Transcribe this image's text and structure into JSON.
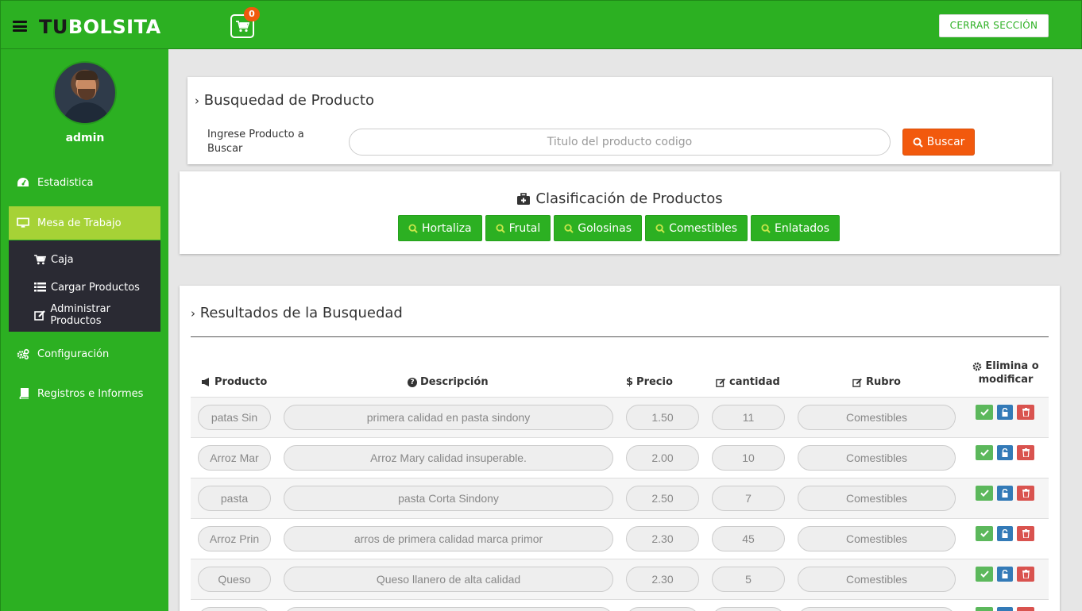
{
  "header": {
    "brand_dark": "TU",
    "brand_light": "BOLSITA",
    "cart_count": "0",
    "logout_label": "CERRAR SECCIÓN"
  },
  "sidebar": {
    "username": "admin",
    "items": [
      {
        "label": "Estadistica",
        "icon": "dashboard-icon"
      },
      {
        "label": "Mesa de Trabajo",
        "icon": "monitor-icon",
        "active": true
      },
      {
        "label": "Configuración",
        "icon": "cogs-icon"
      },
      {
        "label": "Registros e Informes",
        "icon": "book-icon"
      }
    ],
    "subitems": [
      {
        "label": "Caja",
        "icon": "cart-icon"
      },
      {
        "label": "Cargar Productos",
        "icon": "list-icon"
      },
      {
        "label": "Administrar Productos",
        "icon": "edit-icon"
      }
    ]
  },
  "search": {
    "title": "Busquedad de Producto",
    "label": "Ingrese Producto a Buscar",
    "placeholder": "Titulo del producto codigo",
    "button": "Buscar"
  },
  "classification": {
    "title": "Clasificación de Productos",
    "categories": [
      "Hortaliza",
      "Frutal",
      "Golosinas",
      "Comestibles",
      "Enlatados"
    ]
  },
  "results": {
    "title": "Resultados de la Busquedad",
    "columns": {
      "producto": "Producto",
      "descripcion": "Descripción",
      "precio": "Precio",
      "cantidad": "cantidad",
      "rubro": "Rubro",
      "acciones_1": "Elimina o",
      "acciones_2": "modificar"
    },
    "rows": [
      {
        "producto": "patas Sin",
        "descripcion": "primera calidad en pasta sindony",
        "precio": "1.50",
        "cantidad": "11",
        "rubro": "Comestibles"
      },
      {
        "producto": "Arroz Mar",
        "descripcion": "Arroz Mary calidad insuperable.",
        "precio": "2.00",
        "cantidad": "10",
        "rubro": "Comestibles"
      },
      {
        "producto": "pasta",
        "descripcion": "pasta Corta Sindony",
        "precio": "2.50",
        "cantidad": "7",
        "rubro": "Comestibles"
      },
      {
        "producto": "Arroz Prin",
        "descripcion": "arros de primera calidad marca primor",
        "precio": "2.30",
        "cantidad": "45",
        "rubro": "Comestibles"
      },
      {
        "producto": "Queso",
        "descripcion": "Queso llanero de alta calidad",
        "precio": "2.30",
        "cantidad": "5",
        "rubro": "Comestibles"
      },
      {
        "producto": "",
        "descripcion": "",
        "precio": "",
        "cantidad": "",
        "rubro": ""
      }
    ]
  }
}
